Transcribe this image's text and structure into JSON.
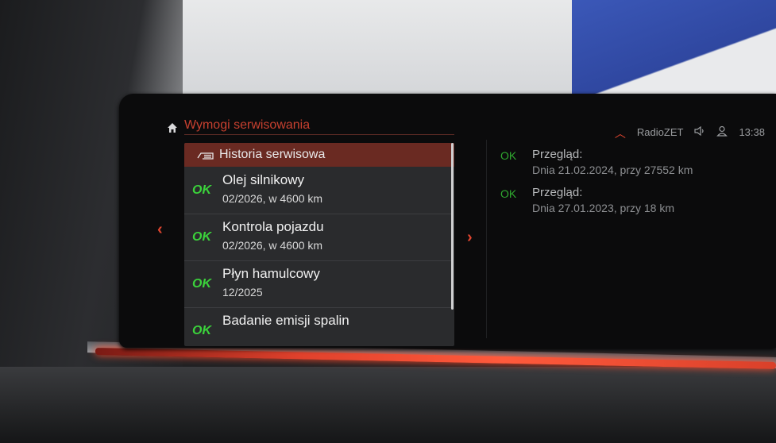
{
  "header": {
    "title": "Wymogi serwisowania",
    "radio": "RadioZET",
    "time": "13:38"
  },
  "icons": {
    "home": "home-icon",
    "history": "service-history-icon",
    "volume": "speaker-icon",
    "user": "user-icon",
    "caret_up": "caret-up-icon",
    "nav_left": "chevron-left-icon",
    "nav_right": "chevron-right-icon"
  },
  "colors": {
    "accent": "#e0452f",
    "ok": "#3bd23b",
    "header_bg": "#6a2a22"
  },
  "list": {
    "header": "Historia serwisowa",
    "items": [
      {
        "status": "OK",
        "name": "Olej silnikowy",
        "detail": "02/2026, w 4600 km"
      },
      {
        "status": "OK",
        "name": "Kontrola pojazdu",
        "detail": "02/2026, w 4600 km"
      },
      {
        "status": "OK",
        "name": "Płyn hamulcowy",
        "detail": "12/2025"
      },
      {
        "status": "OK",
        "name": "Badanie emisji spalin",
        "detail": ""
      }
    ]
  },
  "details": [
    {
      "status": "OK",
      "label": "Przegląd:",
      "date": "Dnia 21.02.2024, przy 27552 km"
    },
    {
      "status": "OK",
      "label": "Przegląd:",
      "date": "Dnia 27.01.2023, przy 18 km"
    }
  ]
}
